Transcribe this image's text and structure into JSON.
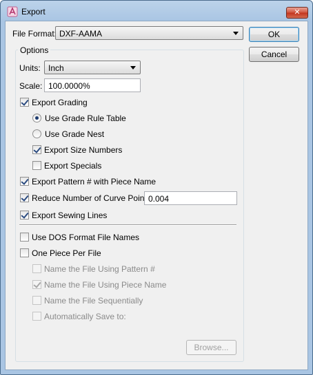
{
  "window": {
    "title": "Export",
    "close_glyph": "✕"
  },
  "file_format": {
    "label": "File Format:",
    "value": "DXF-AAMA"
  },
  "buttons": {
    "ok": "OK",
    "cancel": "Cancel",
    "browse": "Browse..."
  },
  "options": {
    "title": "Options",
    "units": {
      "label": "Units:",
      "value": "Inch"
    },
    "scale": {
      "label": "Scale:",
      "value": "100.0000%"
    },
    "export_grading": {
      "label": "Export Grading",
      "checked": true
    },
    "use_grade_rule_table": {
      "label": "Use Grade Rule Table",
      "selected": true
    },
    "use_grade_nest": {
      "label": "Use Grade Nest",
      "selected": false
    },
    "export_size_numbers": {
      "label": "Export Size Numbers",
      "checked": true
    },
    "export_specials": {
      "label": "Export Specials",
      "checked": false
    },
    "export_pattern_with_piece_name": {
      "label": "Export Pattern # with Piece Name",
      "checked": true
    },
    "reduce_curve_points": {
      "label": "Reduce Number of Curve Points",
      "checked": true,
      "value": "0.004"
    },
    "export_sewing_lines": {
      "label": "Export Sewing Lines",
      "checked": true
    },
    "use_dos_format": {
      "label": "Use DOS Format File Names",
      "checked": false
    },
    "one_piece_per_file": {
      "label": "One Piece Per File",
      "checked": false
    },
    "name_using_pattern": {
      "label": "Name the File Using Pattern #",
      "checked": false,
      "enabled": false
    },
    "name_using_piece_name": {
      "label": "Name the File Using Piece Name",
      "checked": true,
      "enabled": false
    },
    "name_sequentially": {
      "label": "Name the File Sequentially",
      "checked": false,
      "enabled": false
    },
    "auto_save": {
      "label": "Automatically Save to:",
      "checked": false,
      "enabled": false
    }
  }
}
